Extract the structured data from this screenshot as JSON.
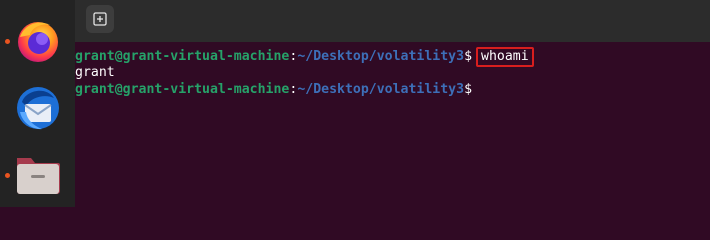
{
  "header": {
    "new_tab_icon": "plus-in-box-icon"
  },
  "dock": {
    "items": [
      {
        "name": "firefox",
        "icon": "firefox-icon",
        "running": true
      },
      {
        "name": "thunderbird",
        "icon": "thunderbird-icon",
        "running": false
      },
      {
        "name": "files",
        "icon": "folder-icon",
        "running": true
      }
    ]
  },
  "terminal": {
    "prompt_user_host": "grant@grant-virtual-machine",
    "prompt_colon": ":",
    "prompt_path": "~/Desktop/volatility3",
    "prompt_dollar": "$",
    "command": "whoami",
    "output": "grant"
  },
  "colors": {
    "background": "#300a24",
    "prompt_green": "#26a269",
    "prompt_blue": "#3d6fb8",
    "highlight_red": "#d81e1e",
    "running_dot": "#e95420"
  }
}
